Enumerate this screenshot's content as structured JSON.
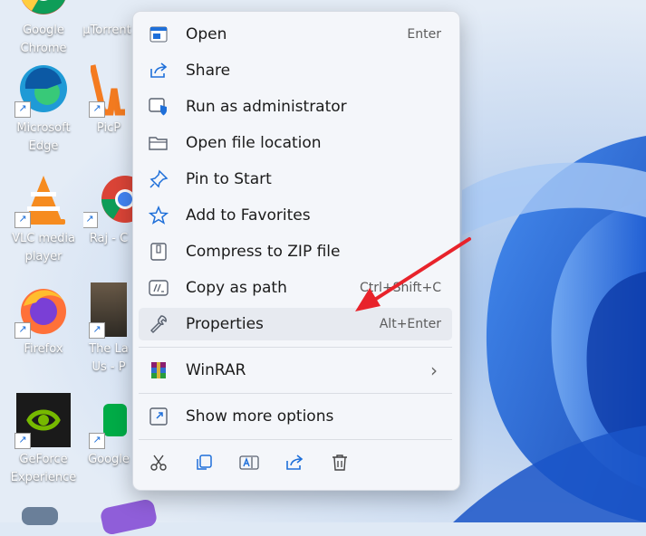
{
  "desktop_icons": [
    {
      "label": "Google Chrome",
      "icon": "chrome-icon"
    },
    {
      "label": "µTorrent",
      "icon": "utorrent-icon"
    },
    {
      "label": "Microsoft Edge",
      "icon": "edge-icon"
    },
    {
      "label": "PicP",
      "icon": "picpick-icon"
    },
    {
      "label": "VLC media player",
      "icon": "vlc-icon"
    },
    {
      "label": "Raj - C",
      "icon": "chrome-icon"
    },
    {
      "label": "Firefox",
      "icon": "firefox-icon"
    },
    {
      "label": "The La Us - P",
      "icon": "game-icon"
    },
    {
      "label": "GeForce Experience",
      "icon": "nvidia-icon"
    },
    {
      "label": "Google",
      "icon": "google-meet-icon"
    }
  ],
  "menu": {
    "items": [
      {
        "label": "Open",
        "shortcut": "Enter",
        "icon": "open-icon"
      },
      {
        "label": "Share",
        "shortcut": "",
        "icon": "share-icon"
      },
      {
        "label": "Run as administrator",
        "shortcut": "",
        "icon": "shield-icon"
      },
      {
        "label": "Open file location",
        "shortcut": "",
        "icon": "folder-icon"
      },
      {
        "label": "Pin to Start",
        "shortcut": "",
        "icon": "pin-icon"
      },
      {
        "label": "Add to Favorites",
        "shortcut": "",
        "icon": "star-icon"
      },
      {
        "label": "Compress to ZIP file",
        "shortcut": "",
        "icon": "zip-icon"
      },
      {
        "label": "Copy as path",
        "shortcut": "Ctrl+Shift+C",
        "icon": "path-icon"
      },
      {
        "label": "Properties",
        "shortcut": "Alt+Enter",
        "icon": "wrench-icon"
      }
    ],
    "winrar": {
      "label": "WinRAR",
      "icon": "winrar-icon",
      "submenu_glyph": "›"
    },
    "more": {
      "label": "Show more options",
      "icon": "more-options-icon"
    },
    "toolbar": [
      "cut-icon",
      "copy-icon",
      "rename-icon",
      "share-icon",
      "delete-icon"
    ]
  },
  "colors": {
    "menu_bg": "#f4f6fa",
    "hover_bg": "#e7eaf0",
    "accent": "#1e6fd9",
    "arrow": "#e8232b"
  }
}
